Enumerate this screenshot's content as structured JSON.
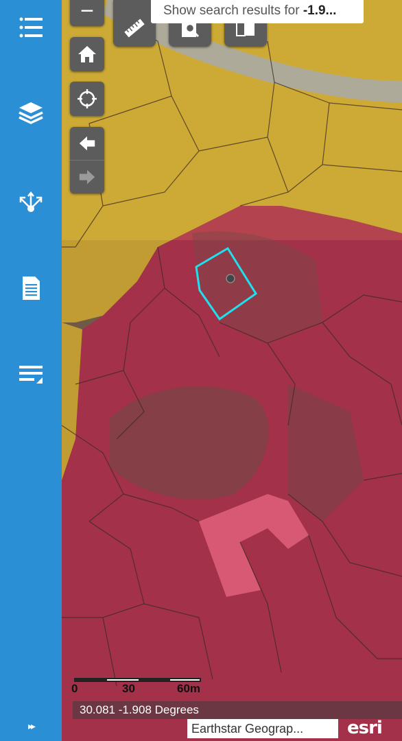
{
  "sidebar": {
    "items": [
      {
        "name": "list",
        "icon": "list-icon"
      },
      {
        "name": "layers",
        "icon": "layers-icon"
      },
      {
        "name": "share",
        "icon": "share-icon"
      },
      {
        "name": "document",
        "icon": "document-icon"
      },
      {
        "name": "edit",
        "icon": "edit-list-icon"
      }
    ],
    "expand_label": "▸▸"
  },
  "search": {
    "hint_prefix": "Show search results for ",
    "hint_query": "-1.9..."
  },
  "map": {
    "zoom_out_label": "−",
    "scale_labels": [
      "0",
      "30",
      "60m"
    ],
    "coordinates": "30.081 -1.908 Degrees",
    "attribution": "Earthstar Geograp...",
    "logo": "esri"
  },
  "colors": {
    "sidebar": "#2b8fd6",
    "zone_yellow": "#e0b52a",
    "zone_red": "#c2184a",
    "selection": "#1ee0ee",
    "controls": "#5c5c5c"
  }
}
